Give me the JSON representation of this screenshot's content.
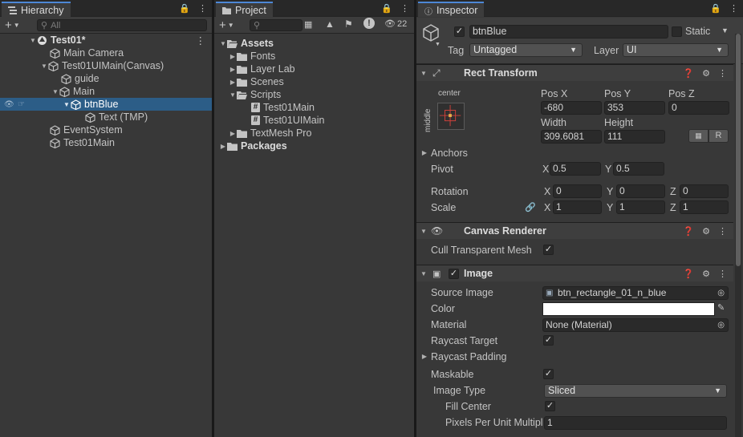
{
  "hierarchy": {
    "tab_title": "Hierarchy",
    "search_placeholder": "All",
    "rows": [
      {
        "label": "Test01*"
      },
      {
        "label": "Main Camera"
      },
      {
        "label": "Test01UIMain(Canvas)"
      },
      {
        "label": "guide"
      },
      {
        "label": "Main"
      },
      {
        "label": "btnBlue"
      },
      {
        "label": "Text (TMP)"
      },
      {
        "label": "EventSystem"
      },
      {
        "label": "Test01Main"
      }
    ]
  },
  "project": {
    "tab_title": "Project",
    "hidden_count": "22",
    "rows": [
      {
        "label": "Assets"
      },
      {
        "label": "Fonts"
      },
      {
        "label": "Layer Lab"
      },
      {
        "label": "Scenes"
      },
      {
        "label": "Scripts"
      },
      {
        "label": "Test01Main"
      },
      {
        "label": "Test01UIMain"
      },
      {
        "label": "TextMesh Pro"
      },
      {
        "label": "Packages"
      }
    ]
  },
  "inspector": {
    "tab_title": "Inspector",
    "object_name": "btnBlue",
    "active": true,
    "static_label": "Static",
    "tag_label": "Tag",
    "tag_value": "Untagged",
    "layer_label": "Layer",
    "layer_value": "UI",
    "rect_transform": {
      "title": "Rect Transform",
      "anchor_h": "center",
      "anchor_v": "middle",
      "pos_x_label": "Pos X",
      "pos_x": "-680",
      "pos_y_label": "Pos Y",
      "pos_y": "353",
      "pos_z_label": "Pos Z",
      "pos_z": "0",
      "width_label": "Width",
      "width": "309.6081",
      "height_label": "Height",
      "height": "111",
      "r_button": "R",
      "anchors_label": "Anchors",
      "pivot_label": "Pivot",
      "pivot_x": "0.5",
      "pivot_y": "0.5",
      "rotation_label": "Rotation",
      "rot_x": "0",
      "rot_y": "0",
      "rot_z": "0",
      "scale_label": "Scale",
      "scale_x": "1",
      "scale_y": "1",
      "scale_z": "1",
      "x": "X",
      "y": "Y",
      "z": "Z"
    },
    "canvas_renderer": {
      "title": "Canvas Renderer",
      "cull_label": "Cull Transparent Mesh",
      "cull_checked": true
    },
    "image": {
      "title": "Image",
      "source_image_label": "Source Image",
      "source_image": "btn_rectangle_01_n_blue",
      "color_label": "Color",
      "color_value": "#ffffff",
      "material_label": "Material",
      "material": "None (Material)",
      "raycast_target_label": "Raycast Target",
      "raycast_padding_label": "Raycast Padding",
      "maskable_label": "Maskable",
      "image_type_label": "Image Type",
      "image_type": "Sliced",
      "fill_center_label": "Fill Center",
      "ppu_label": "Pixels Per Unit Multipl",
      "ppu": "1"
    }
  },
  "colors": {
    "selection": "#2c5d87",
    "tab_accent": "#4d88d6",
    "panel_bg": "#383838"
  }
}
